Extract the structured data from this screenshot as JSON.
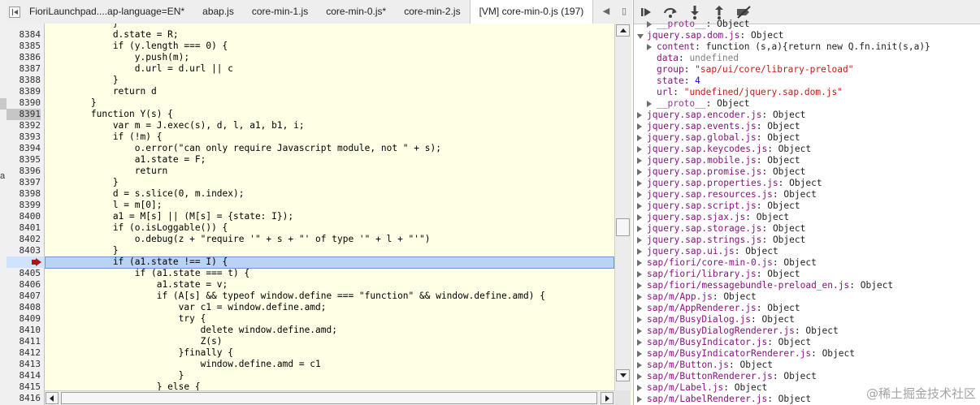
{
  "tabs": [
    {
      "label": "FioriLaunchpad....ap-language=EN*",
      "active": false
    },
    {
      "label": "abap.js",
      "active": false
    },
    {
      "label": "core-min-1.js",
      "active": false
    },
    {
      "label": "core-min-0.js*",
      "active": false
    },
    {
      "label": "core-min-2.js",
      "active": false
    },
    {
      "label": "[VM] core-min-0.js (197)",
      "active": true
    }
  ],
  "left_strip_label": "a",
  "code": [
    {
      "n": "",
      "t": "            }"
    },
    {
      "n": "8384",
      "t": "            d.state = R;"
    },
    {
      "n": "8385",
      "t": "            if (y.length === 0) {"
    },
    {
      "n": "8386",
      "t": "                y.push(m);"
    },
    {
      "n": "8387",
      "t": "                d.url = d.url || c"
    },
    {
      "n": "8388",
      "t": "            }"
    },
    {
      "n": "8389",
      "t": "            return d"
    },
    {
      "n": "8390",
      "t": "        }"
    },
    {
      "n": "8391",
      "t": "        function Y(s) {"
    },
    {
      "n": "8392",
      "t": "            var m = J.exec(s), d, l, a1, b1, i;"
    },
    {
      "n": "8393",
      "t": "            if (!m) {"
    },
    {
      "n": "8394",
      "t": "                o.error(\"can only require Javascript module, not \" + s);"
    },
    {
      "n": "8395",
      "t": "                a1.state = F;"
    },
    {
      "n": "8396",
      "t": "                return"
    },
    {
      "n": "8397",
      "t": "            }"
    },
    {
      "n": "8398",
      "t": "            d = s.slice(0, m.index);"
    },
    {
      "n": "8399",
      "t": "            l = m[0];"
    },
    {
      "n": "8400",
      "t": "            a1 = M[s] || (M[s] = {state: I});"
    },
    {
      "n": "8401",
      "t": "            if (o.isLoggable()) {"
    },
    {
      "n": "8402",
      "t": "                o.debug(z + \"require '\" + s + \"' of type '\" + l + \"'\")"
    },
    {
      "n": "8403",
      "t": "            }"
    },
    {
      "n": "8404",
      "t": "            if (a1.state !== I) {",
      "exec": true
    },
    {
      "n": "8405",
      "t": "                if (a1.state === t) {"
    },
    {
      "n": "8406",
      "t": "                    a1.state = v;"
    },
    {
      "n": "8407",
      "t": "                    if (A[s] && typeof window.define === \"function\" && window.define.amd) {"
    },
    {
      "n": "8408",
      "t": "                        var c1 = window.define.amd;"
    },
    {
      "n": "8409",
      "t": "                        try {"
    },
    {
      "n": "8410",
      "t": "                            delete window.define.amd;"
    },
    {
      "n": "8411",
      "t": "                            Z(s)"
    },
    {
      "n": "8412",
      "t": "                        }finally {"
    },
    {
      "n": "8413",
      "t": "                            window.define.amd = c1"
    },
    {
      "n": "8414",
      "t": "                        }"
    },
    {
      "n": "8415",
      "t": "                    } else {"
    },
    {
      "n": "8416",
      "t": ""
    }
  ],
  "debug_toolbar": [
    "resume-icon",
    "step-over-icon",
    "step-into-icon",
    "step-out-icon",
    "deactivate-breakpoints-icon"
  ],
  "scope": [
    {
      "indent": 1,
      "tw": "right",
      "key": "__proto__",
      "sep": ": ",
      "val": "Object",
      "vclass": "v-plain",
      "kclass": "kgray"
    },
    {
      "indent": 0,
      "tw": "down",
      "key": "jquery.sap.dom.js",
      "sep": ": ",
      "val": "Object",
      "vclass": "v-plain"
    },
    {
      "indent": 1,
      "tw": "right",
      "key": "content",
      "sep": ": ",
      "val": "function (s,a){return new Q.fn.init(s,a)}",
      "vclass": "v-plain"
    },
    {
      "indent": 1,
      "tw": "",
      "key": "data",
      "sep": ": ",
      "val": "undefined",
      "vclass": "v-gray"
    },
    {
      "indent": 1,
      "tw": "",
      "key": "group",
      "sep": ": ",
      "val": "\"sap/ui/core/library-preload\"",
      "vclass": "v-str"
    },
    {
      "indent": 1,
      "tw": "",
      "key": "state",
      "sep": ": ",
      "val": "4",
      "vclass": "v-num"
    },
    {
      "indent": 1,
      "tw": "",
      "key": "url",
      "sep": ": ",
      "val": "\"undefined/jquery.sap.dom.js\"",
      "vclass": "v-str"
    },
    {
      "indent": 1,
      "tw": "right",
      "key": "__proto__",
      "sep": ": ",
      "val": "Object",
      "vclass": "v-plain",
      "kclass": "kgray"
    },
    {
      "indent": 0,
      "tw": "right",
      "key": "jquery.sap.encoder.js",
      "sep": ": ",
      "val": "Object",
      "vclass": "v-plain"
    },
    {
      "indent": 0,
      "tw": "right",
      "key": "jquery.sap.events.js",
      "sep": ": ",
      "val": "Object",
      "vclass": "v-plain"
    },
    {
      "indent": 0,
      "tw": "right",
      "key": "jquery.sap.global.js",
      "sep": ": ",
      "val": "Object",
      "vclass": "v-plain"
    },
    {
      "indent": 0,
      "tw": "right",
      "key": "jquery.sap.keycodes.js",
      "sep": ": ",
      "val": "Object",
      "vclass": "v-plain"
    },
    {
      "indent": 0,
      "tw": "right",
      "key": "jquery.sap.mobile.js",
      "sep": ": ",
      "val": "Object",
      "vclass": "v-plain"
    },
    {
      "indent": 0,
      "tw": "right",
      "key": "jquery.sap.promise.js",
      "sep": ": ",
      "val": "Object",
      "vclass": "v-plain"
    },
    {
      "indent": 0,
      "tw": "right",
      "key": "jquery.sap.properties.js",
      "sep": ": ",
      "val": "Object",
      "vclass": "v-plain"
    },
    {
      "indent": 0,
      "tw": "right",
      "key": "jquery.sap.resources.js",
      "sep": ": ",
      "val": "Object",
      "vclass": "v-plain"
    },
    {
      "indent": 0,
      "tw": "right",
      "key": "jquery.sap.script.js",
      "sep": ": ",
      "val": "Object",
      "vclass": "v-plain"
    },
    {
      "indent": 0,
      "tw": "right",
      "key": "jquery.sap.sjax.js",
      "sep": ": ",
      "val": "Object",
      "vclass": "v-plain"
    },
    {
      "indent": 0,
      "tw": "right",
      "key": "jquery.sap.storage.js",
      "sep": ": ",
      "val": "Object",
      "vclass": "v-plain"
    },
    {
      "indent": 0,
      "tw": "right",
      "key": "jquery.sap.strings.js",
      "sep": ": ",
      "val": "Object",
      "vclass": "v-plain"
    },
    {
      "indent": 0,
      "tw": "right",
      "key": "jquery.sap.ui.js",
      "sep": ": ",
      "val": "Object",
      "vclass": "v-plain"
    },
    {
      "indent": 0,
      "tw": "right",
      "key": "sap/fiori/core-min-0.js",
      "sep": ": ",
      "val": "Object",
      "vclass": "v-plain"
    },
    {
      "indent": 0,
      "tw": "right",
      "key": "sap/fiori/library.js",
      "sep": ": ",
      "val": "Object",
      "vclass": "v-plain"
    },
    {
      "indent": 0,
      "tw": "right",
      "key": "sap/fiori/messagebundle-preload_en.js",
      "sep": ": ",
      "val": "Object",
      "vclass": "v-plain"
    },
    {
      "indent": 0,
      "tw": "right",
      "key": "sap/m/App.js",
      "sep": ": ",
      "val": "Object",
      "vclass": "v-plain"
    },
    {
      "indent": 0,
      "tw": "right",
      "key": "sap/m/AppRenderer.js",
      "sep": ": ",
      "val": "Object",
      "vclass": "v-plain"
    },
    {
      "indent": 0,
      "tw": "right",
      "key": "sap/m/BusyDialog.js",
      "sep": ": ",
      "val": "Object",
      "vclass": "v-plain"
    },
    {
      "indent": 0,
      "tw": "right",
      "key": "sap/m/BusyDialogRenderer.js",
      "sep": ": ",
      "val": "Object",
      "vclass": "v-plain"
    },
    {
      "indent": 0,
      "tw": "right",
      "key": "sap/m/BusyIndicator.js",
      "sep": ": ",
      "val": "Object",
      "vclass": "v-plain"
    },
    {
      "indent": 0,
      "tw": "right",
      "key": "sap/m/BusyIndicatorRenderer.js",
      "sep": ": ",
      "val": "Object",
      "vclass": "v-plain"
    },
    {
      "indent": 0,
      "tw": "right",
      "key": "sap/m/Button.js",
      "sep": ": ",
      "val": "Object",
      "vclass": "v-plain"
    },
    {
      "indent": 0,
      "tw": "right",
      "key": "sap/m/ButtonRenderer.js",
      "sep": ": ",
      "val": "Object",
      "vclass": "v-plain"
    },
    {
      "indent": 0,
      "tw": "right",
      "key": "sap/m/Label.js",
      "sep": ": ",
      "val": "Object",
      "vclass": "v-plain"
    },
    {
      "indent": 0,
      "tw": "right",
      "key": "sap/m/LabelRenderer.js",
      "sep": ": ",
      "val": "Object",
      "vclass": "v-plain"
    }
  ],
  "watermark": "@稀土掘金技术社区"
}
